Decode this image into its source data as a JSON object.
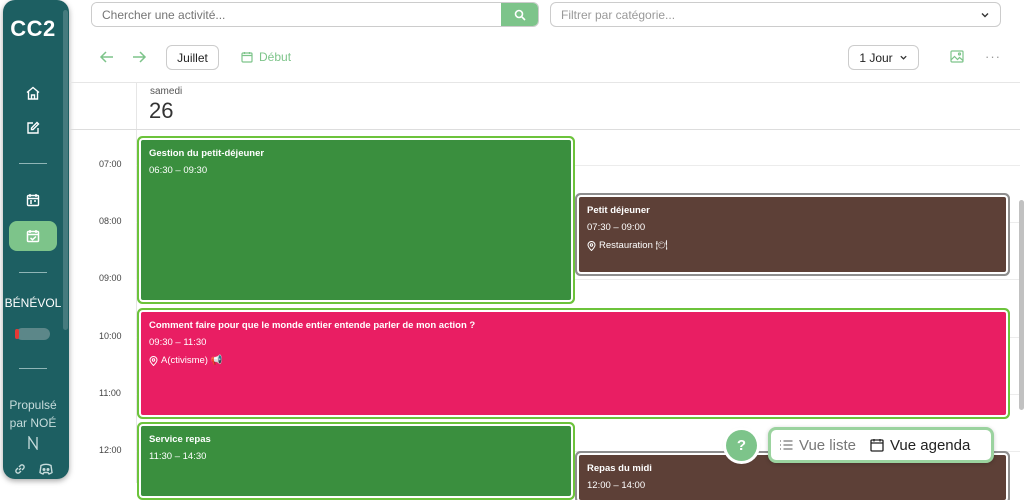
{
  "sidebar": {
    "logo": "CC2",
    "section_label": "BÉNÉVOL",
    "powered_line1": "Propulsé",
    "powered_line2": "par NOÉ"
  },
  "search": {
    "placeholder": "Chercher une activité..."
  },
  "filter": {
    "placeholder": "Filtrer par catégorie..."
  },
  "toolbar": {
    "month_label": "Juillet",
    "start_label": "Début",
    "range_label": "1 Jour"
  },
  "day": {
    "name": "samedi",
    "number": "26"
  },
  "hours": [
    "07:00",
    "08:00",
    "09:00",
    "10:00",
    "11:00",
    "12:00"
  ],
  "events": [
    {
      "title": "Gestion du petit-déjeuner",
      "time": "06:30 – 09:30",
      "place": ""
    },
    {
      "title": "Petit déjeuner",
      "time": "07:30 – 09:00",
      "place": "Restauration 🍽"
    },
    {
      "title": "Comment faire pour que le monde entier entende parler de mon action ?",
      "time": "09:30 – 11:30",
      "place": "A(ctivisme) 📢"
    },
    {
      "title": "Service repas",
      "time": "11:30 – 14:30",
      "place": ""
    },
    {
      "title": "Repas du midi",
      "time": "12:00 – 14:00",
      "place": ""
    }
  ],
  "help": {
    "label": "?"
  },
  "view_switch": {
    "list_label": "Vue liste",
    "agenda_label": "Vue agenda"
  },
  "colors": {
    "sidebar": "#1d5f62",
    "accent": "#7dc48a",
    "event_green": "#3a8f3e",
    "event_brown": "#5d4037",
    "event_pink": "#e91e63"
  }
}
